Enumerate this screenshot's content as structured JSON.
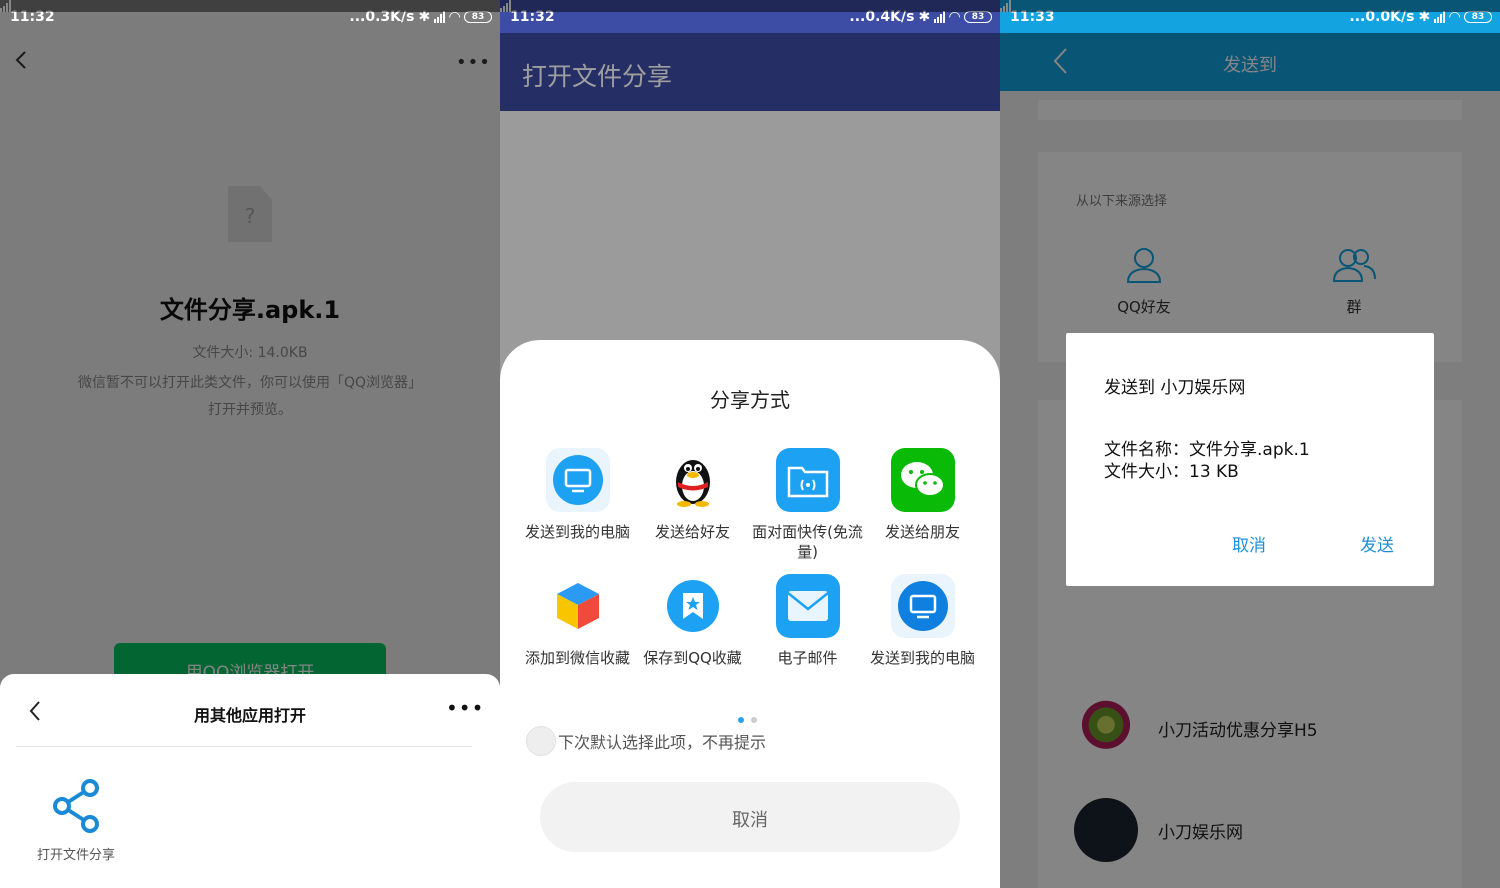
{
  "screen1": {
    "status": {
      "time": "11:32",
      "speed": "...0.3K/s",
      "battery": "83"
    },
    "file_name": "文件分享.apk.1",
    "file_size": "文件大小: 14.0KB",
    "tip": "微信暂不可以打开此类文件，你可以使用「QQ浏览器」打开并预览。",
    "open_button": "用QQ浏览器打开",
    "sheet": {
      "title": "用其他应用打开",
      "app_label": "打开文件分享"
    }
  },
  "screen2": {
    "status": {
      "time": "11:32",
      "speed": "...0.4K/s",
      "battery": "83"
    },
    "title": "打开文件分享",
    "sheet_title": "分享方式",
    "apps": [
      {
        "label": "发送到我的电脑",
        "icon": "computer-icon"
      },
      {
        "label": "发送给好友",
        "icon": "qq-penguin-icon"
      },
      {
        "label": "面对面快传(免流量)",
        "icon": "face-to-face-transfer-icon"
      },
      {
        "label": "发送给朋友",
        "icon": "wechat-icon"
      },
      {
        "label": "添加到微信收藏",
        "icon": "cube-icon"
      },
      {
        "label": "保存到QQ收藏",
        "icon": "favorite-star-icon"
      },
      {
        "label": "电子邮件",
        "icon": "mail-icon"
      },
      {
        "label": "发送到我的电脑",
        "icon": "computer-icon"
      }
    ],
    "default_check_label": "下次默认选择此项，不再提示",
    "cancel": "取消"
  },
  "screen3": {
    "status": {
      "time": "11:33",
      "speed": "...0.0K/s",
      "battery": "83"
    },
    "title": "发送到",
    "source_label": "从以下来源选择",
    "categories": [
      "QQ好友",
      "群"
    ],
    "contacts": [
      "小刀活动优惠分享H5",
      "小刀娱乐网"
    ],
    "dialog": {
      "title": "发送到 小刀娱乐网",
      "file_name_line": "文件名称：文件分享.apk.1",
      "file_size_line": "文件大小：13 KB",
      "cancel": "取消",
      "send": "发送"
    }
  },
  "colors": {
    "wechat_green": "#07c160",
    "indigo_bar": "#3d4da5",
    "qq_blue": "#12a3e0",
    "accent_blue": "#1e8fd6"
  }
}
